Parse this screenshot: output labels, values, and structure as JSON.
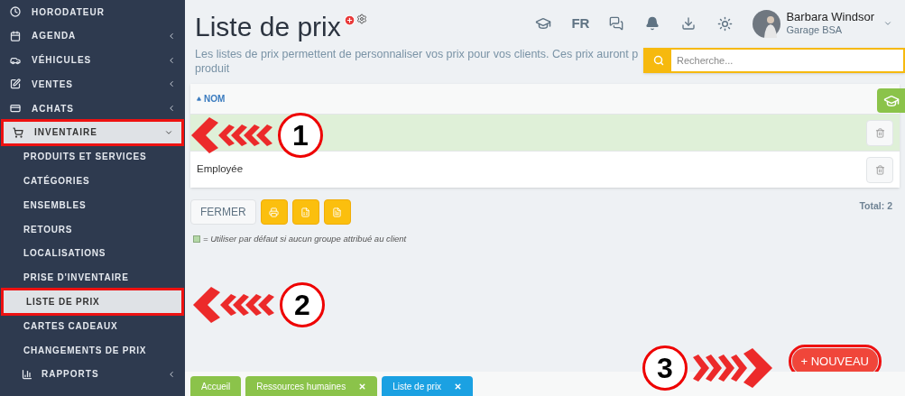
{
  "sidebar": {
    "items": [
      {
        "label": "HORODATEUR",
        "expandable": false,
        "selected": false,
        "annotated": false
      },
      {
        "label": "AGENDA",
        "expandable": true,
        "expanded": false,
        "selected": false,
        "annotated": false
      },
      {
        "label": "VÉHICULES",
        "expandable": true,
        "expanded": false,
        "selected": false,
        "annotated": false
      },
      {
        "label": "VENTES",
        "expandable": true,
        "expanded": false,
        "selected": false,
        "annotated": false
      },
      {
        "label": "ACHATS",
        "expandable": true,
        "expanded": false,
        "selected": false,
        "annotated": false
      },
      {
        "label": "INVENTAIRE",
        "expandable": true,
        "expanded": true,
        "selected": true,
        "annotated": true,
        "children": [
          {
            "label": "PRODUITS ET SERVICES",
            "kind": "link",
            "selected": false,
            "annotated": false
          },
          {
            "label": "CATÉGORIES",
            "kind": "link",
            "selected": false,
            "annotated": false
          },
          {
            "label": "ENSEMBLES",
            "kind": "link",
            "selected": false,
            "annotated": false
          },
          {
            "label": "RETOURS",
            "kind": "link",
            "selected": false,
            "annotated": false
          },
          {
            "label": "LOCALISATIONS",
            "kind": "link",
            "selected": false,
            "annotated": false
          },
          {
            "label": "PRISE D'INVENTAIRE",
            "kind": "link",
            "selected": false,
            "annotated": false
          },
          {
            "label": "LISTE DE PRIX",
            "kind": "link",
            "selected": true,
            "annotated": true
          },
          {
            "label": "CARTES CADEAUX",
            "kind": "link",
            "selected": false,
            "annotated": false
          },
          {
            "label": "CHANGEMENTS DE PRIX",
            "kind": "link",
            "selected": false,
            "annotated": false
          },
          {
            "label": "RAPPORTS",
            "kind": "group",
            "selected": false,
            "annotated": false
          }
        ]
      }
    ]
  },
  "page": {
    "title": "Liste de prix",
    "description_lines": [
      "Les listes de prix permettent de personnaliser vos prix pour vos clients. Ces prix auront p",
      "produit"
    ]
  },
  "topbar": {
    "language": "FR",
    "user": {
      "name": "Barbara Windsor",
      "company": "Garage BSA"
    }
  },
  "search": {
    "placeholder": "Recherche..."
  },
  "table": {
    "columns": [
      {
        "label": "NOM",
        "sorted": true
      }
    ],
    "rows": [
      {
        "default": true
      },
      {
        "name": "Employée",
        "default": false
      }
    ],
    "total": "Total: 2"
  },
  "toolbar": {
    "close_label": "FERMER"
  },
  "legend": "= Utiliser par défaut si aucun groupe attribué au client",
  "new_button": {
    "label": "+ NOUVEAU",
    "annotated": true
  },
  "tabs": [
    {
      "label": "Accueil",
      "selected": false,
      "closable": false
    },
    {
      "label": "Ressources humaines",
      "selected": false,
      "closable": true
    },
    {
      "label": "Liste de prix",
      "selected": true,
      "closable": true
    }
  ],
  "annotations": [
    {
      "number": "1"
    },
    {
      "number": "2"
    },
    {
      "number": "3"
    }
  ]
}
